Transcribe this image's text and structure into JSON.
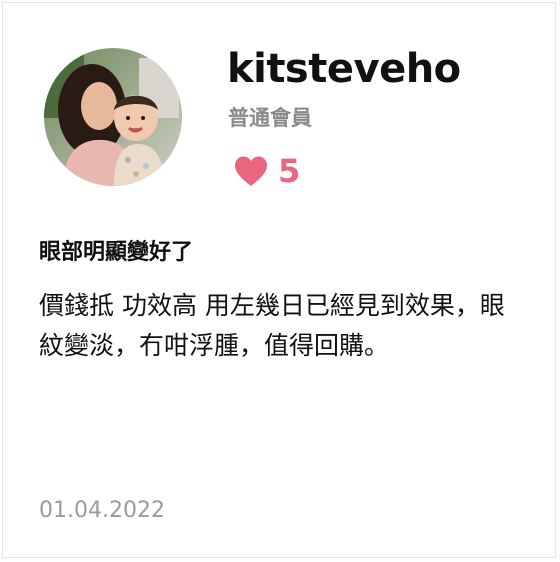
{
  "reviewer": {
    "username": "kitsteveho",
    "member_level": "普通會員",
    "avatar_icon": "user-avatar-photo"
  },
  "likes": {
    "icon": "heart-icon",
    "count": "5",
    "color": "#e8677d"
  },
  "review": {
    "title": "眼部明顯變好了",
    "body": "價錢抵 功效高 用左幾日已經見到效果，眼紋變淡，冇咁浮腫，值得回購。",
    "date": "01.04.2022"
  }
}
